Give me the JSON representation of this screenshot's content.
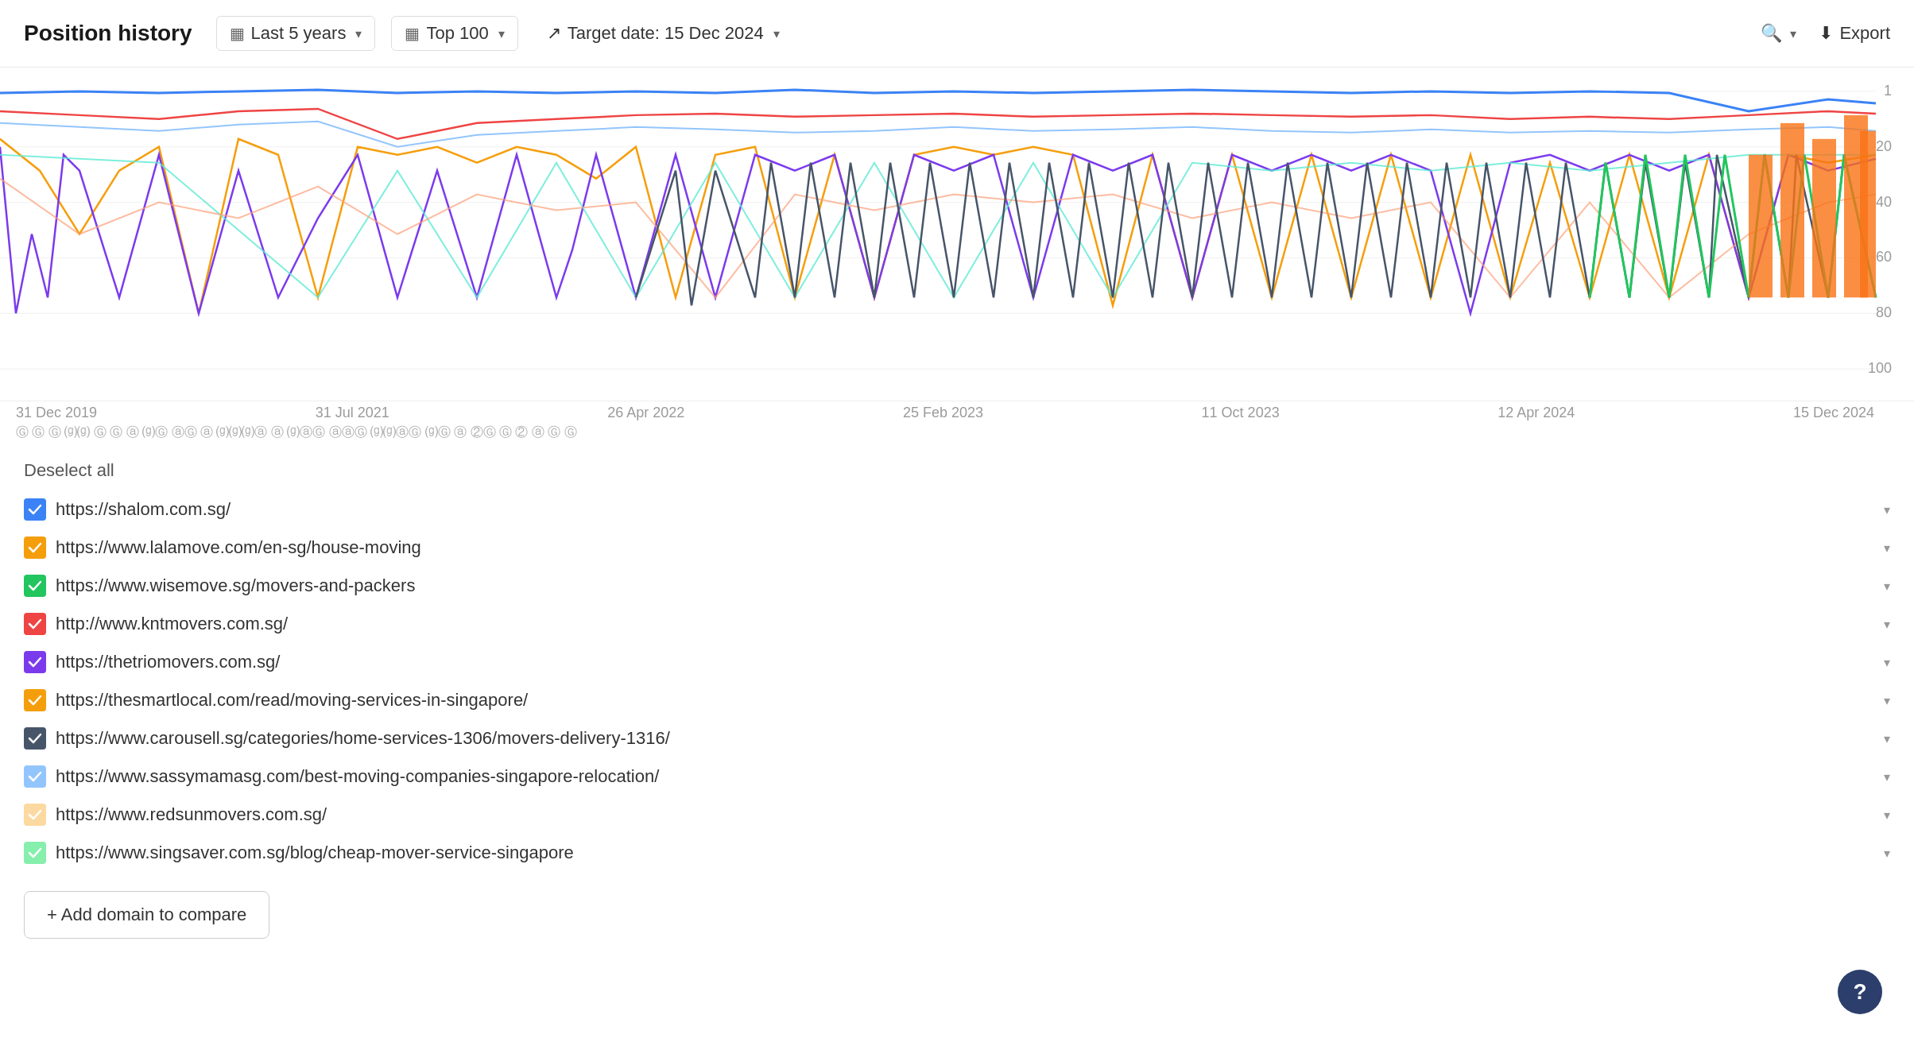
{
  "header": {
    "title": "Position history",
    "time_filter_label": "Last 5 years",
    "top_filter_label": "Top 100",
    "target_date_label": "Target date: 15 Dec 2024",
    "export_label": "Export",
    "search_placeholder": ""
  },
  "chart": {
    "x_labels": [
      "31 Dec 2019",
      "31 Jul 2021",
      "26 Apr 2022",
      "25 Feb 2023",
      "11 Oct 2023",
      "12 Apr 2024",
      "15 Dec 2024"
    ],
    "y_labels": [
      "1",
      "20",
      "40",
      "60",
      "80",
      "100"
    ],
    "algo_marker_label": "G"
  },
  "legend": {
    "deselect_label": "Deselect all"
  },
  "domains": [
    {
      "url": "https://shalom.com.sg/",
      "color": "#3b82f6",
      "checked": true,
      "checkmark": "#3b82f6"
    },
    {
      "url": "https://www.lalamove.com/en-sg/house-moving",
      "color": "#f59e0b",
      "checked": true,
      "checkmark": "#f59e0b"
    },
    {
      "url": "https://www.wisemove.sg/movers-and-packers",
      "color": "#22c55e",
      "checked": true,
      "checkmark": "#22c55e"
    },
    {
      "url": "http://www.kntmovers.com.sg/",
      "color": "#ef4444",
      "checked": true,
      "checkmark": "#ef4444"
    },
    {
      "url": "https://thetriomovers.com.sg/",
      "color": "#7c3aed",
      "checked": true,
      "checkmark": "#7c3aed"
    },
    {
      "url": "https://thesmartlocal.com/read/moving-services-in-singapore/",
      "color": "#f59e0b",
      "checked": true,
      "checkmark": "#d4b800"
    },
    {
      "url": "https://www.carousell.sg/categories/home-services-1306/movers-delivery-1316/",
      "color": "#475569",
      "checked": true,
      "checkmark": "#475569"
    },
    {
      "url": "https://www.sassymamasg.com/best-moving-companies-singapore-relocation/",
      "color": "#93c5fd",
      "checked": true,
      "checkmark": "#93c5fd"
    },
    {
      "url": "https://www.redsunmovers.com.sg/",
      "color": "#fcd9a0",
      "checked": true,
      "checkmark": "#fcd9a0"
    },
    {
      "url": "https://www.singsaver.com.sg/blog/cheap-mover-service-singapore",
      "color": "#86efac",
      "checked": true,
      "checkmark": "#86efac"
    }
  ],
  "add_domain_label": "+ Add domain to compare",
  "help_label": "?"
}
